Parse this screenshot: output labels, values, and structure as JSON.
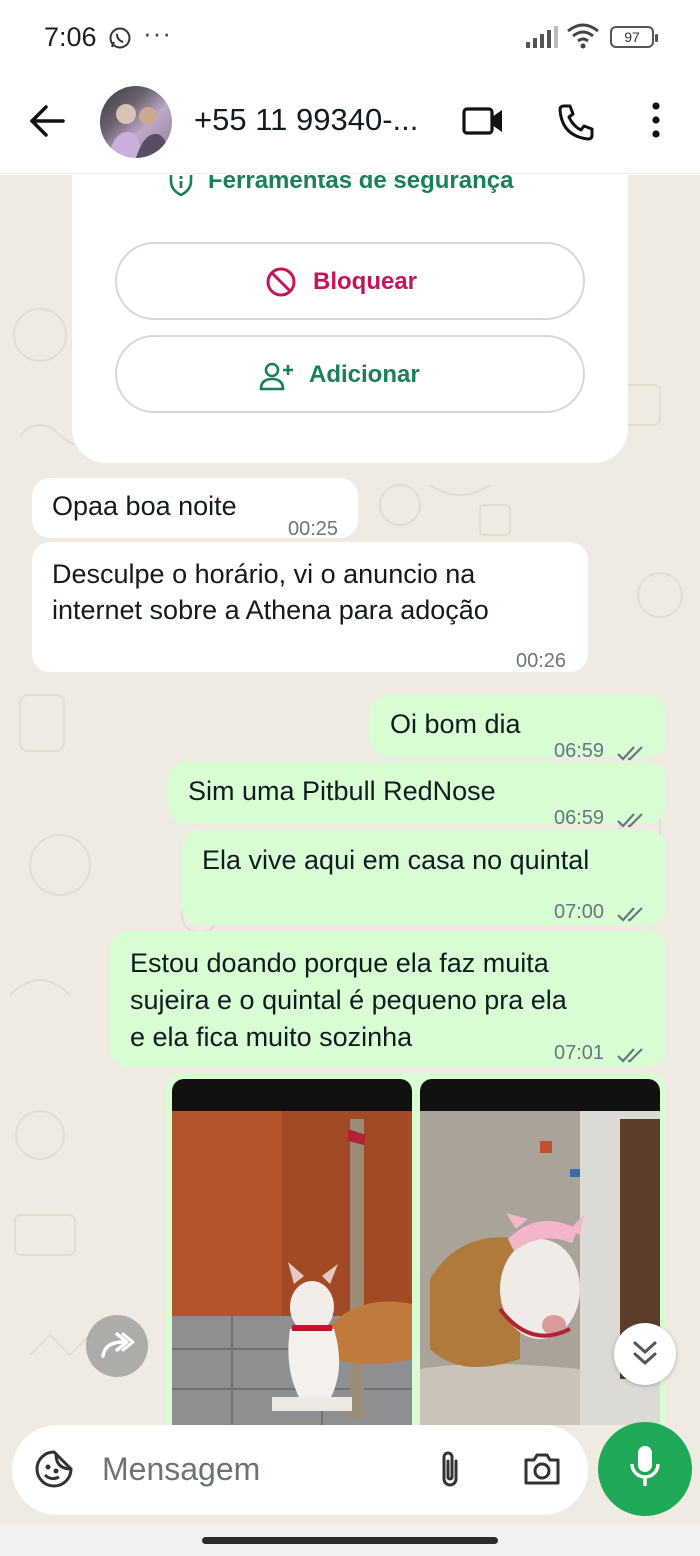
{
  "status_bar": {
    "time": "7:06",
    "battery": "97",
    "icons": [
      "whatsapp-icon",
      "more-dots-icon",
      "signal-icon",
      "wifi-icon",
      "battery-icon"
    ]
  },
  "header": {
    "contact_name": "+55 11 99340-...",
    "icons": [
      "back-arrow-icon",
      "video-call-icon",
      "phone-icon",
      "more-vertical-icon"
    ]
  },
  "safety_card": {
    "title": "Ferramentas de segurança",
    "block_label": "Bloquear",
    "add_label": "Adicionar"
  },
  "messages": [
    {
      "direction": "in",
      "lines": [
        "Opaa boa noite"
      ],
      "time": "00:25"
    },
    {
      "direction": "in",
      "lines": [
        "Desculpe o horário, vi o anuncio na",
        "internet sobre a Athena para adoção"
      ],
      "time": "00:26"
    },
    {
      "direction": "out",
      "lines": [
        "Oi bom dia"
      ],
      "time": "06:59",
      "status": "read-ticks"
    },
    {
      "direction": "out",
      "lines": [
        "Sim uma Pitbull RedNose"
      ],
      "time": "06:59",
      "status": "read-ticks"
    },
    {
      "direction": "out",
      "lines": [
        "Ela vive aqui em casa no quintal"
      ],
      "time": "07:00",
      "status": "read-ticks"
    },
    {
      "direction": "out",
      "lines": [
        "Estou doando porque ela faz muita",
        "sujeira e o quintal é pequeno pra ela",
        "e ela fica muito sozinha"
      ],
      "time": "07:01",
      "status": "read-ticks"
    }
  ],
  "media_message": {
    "direction": "out",
    "photos": [
      "dog-photo-white-pitbull-by-pole",
      "dog-photo-pitbull-with-pink-bow"
    ]
  },
  "composer": {
    "placeholder": "Mensagem",
    "icons": [
      "sticker-icon",
      "attach-icon",
      "camera-icon",
      "mic-icon"
    ]
  },
  "colors": {
    "incoming_bubble": "#ffffff",
    "outgoing_bubble": "#d9fdd3",
    "chat_background": "#efeae2",
    "accent_green": "#1fa855",
    "block_red": "#c4145a",
    "safety_green": "#1a7f5a"
  }
}
